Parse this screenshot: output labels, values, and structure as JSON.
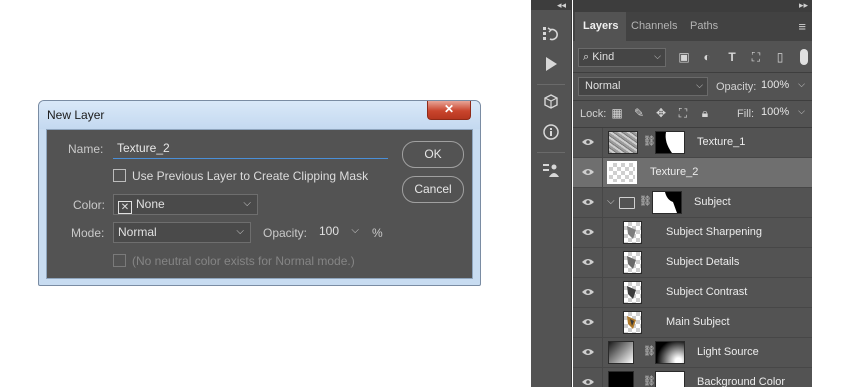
{
  "dialog": {
    "title": "New Layer",
    "close_glyph": "✕",
    "name_label": "Name:",
    "name_value": "Texture_2",
    "clipping_label": "Use Previous Layer to Create Clipping Mask",
    "color_label": "Color:",
    "color_value": "None",
    "mode_label": "Mode:",
    "mode_value": "Normal",
    "opacity_label": "Opacity:",
    "opacity_value": "100",
    "opacity_unit": "%",
    "neutral_label": "(No neutral color exists for Normal mode.)",
    "ok_label": "OK",
    "cancel_label": "Cancel"
  },
  "panel": {
    "tabs": [
      {
        "label": "Layers",
        "active": true
      },
      {
        "label": "Channels",
        "active": false
      },
      {
        "label": "Paths",
        "active": false
      }
    ],
    "filter_kind": "Kind",
    "blend_mode": "Normal",
    "opacity_label": "Opacity:",
    "opacity_value": "100%",
    "lock_label": "Lock:",
    "fill_label": "Fill:",
    "fill_value": "100%",
    "layers": [
      {
        "name": "Texture_1",
        "type": "pixel-masked",
        "selected": false
      },
      {
        "name": "Texture_2",
        "type": "pixel",
        "selected": true
      },
      {
        "name": "Subject",
        "type": "group",
        "selected": false
      },
      {
        "name": "Subject Sharpening",
        "type": "child",
        "selected": false
      },
      {
        "name": "Subject Details",
        "type": "child",
        "selected": false
      },
      {
        "name": "Subject Contrast",
        "type": "child",
        "selected": false
      },
      {
        "name": "Main Subject",
        "type": "child",
        "selected": false
      },
      {
        "name": "Light Source",
        "type": "gradient-masked",
        "selected": false
      },
      {
        "name": "Background Color",
        "type": "fill-masked",
        "selected": false
      }
    ]
  },
  "colors": {
    "panel_bg": "#535353",
    "selected_row": "#6f6f6f",
    "accent_underline": "#4a8fd8",
    "dialog_frame": "#c8dcf1",
    "close_button": "#c9452d"
  }
}
